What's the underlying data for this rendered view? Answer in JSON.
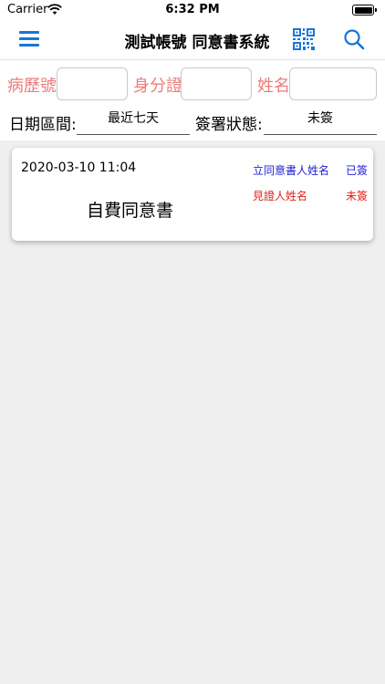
{
  "status_bar": {
    "carrier": "Carrier",
    "time": "6:32 PM"
  },
  "nav": {
    "title": "測試帳號 同意書系統",
    "icons": [
      "menu-icon",
      "qr-code-icon",
      "search-icon"
    ]
  },
  "filters": {
    "medical_record_label": "病歷號",
    "medical_record_value": "",
    "id_label": "身分證",
    "id_value": "",
    "name_label": "姓名",
    "name_value": "",
    "date_range_label": "日期區間:",
    "date_range_value": "最近七天",
    "sign_status_label": "簽署狀態:",
    "sign_status_value": "未簽"
  },
  "records": [
    {
      "datetime": "2020-03-10 11:04",
      "title": "自費同意書",
      "signers": [
        {
          "role": "立同意書人姓名",
          "status": "已簽",
          "color": "#1f1fd6"
        },
        {
          "role": "見證人姓名",
          "status": "未簽",
          "color": "#e0201a"
        }
      ]
    }
  ],
  "colors": {
    "accent": "#1a74d8",
    "label_red": "#ef7b7b",
    "signed_blue": "#1f1fd6",
    "unsigned_red": "#e0201a"
  }
}
